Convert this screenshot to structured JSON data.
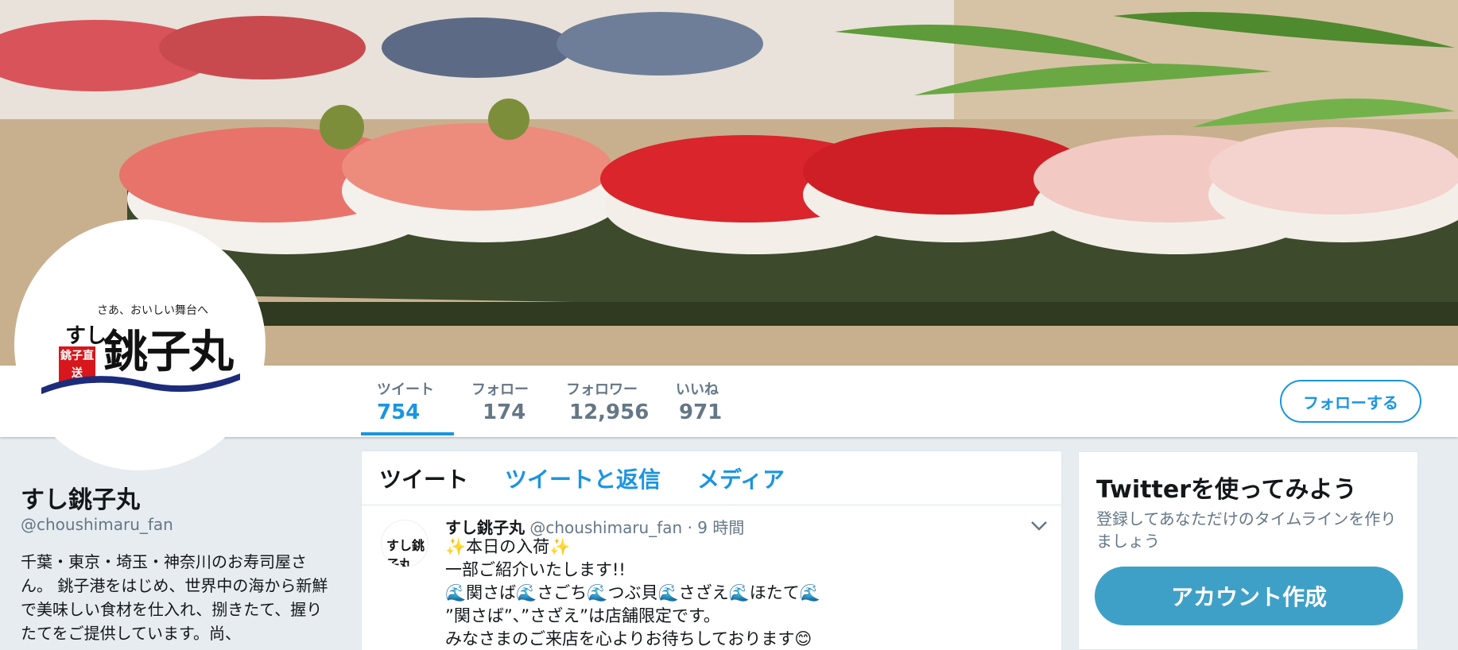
{
  "profile": {
    "avatar_tagline": "さあ、おいしい舞台へ",
    "avatar_prefix": "すし",
    "avatar_brand": "銚子丸",
    "avatar_stamp": "銚子直送",
    "name": "すし銚子丸",
    "handle": "@choushimaru_fan",
    "bio": "千葉・東京・埼玉・神奈川のお寿司屋さん。 銚子港をはじめ、世界中の海から新鮮で美味しい食材を仕入れ、捌きたて、握りたてをご提供しています。尚、"
  },
  "stats": [
    {
      "label": "ツイート",
      "value": "754"
    },
    {
      "label": "フォロー",
      "value": "174"
    },
    {
      "label": "フォロワー",
      "value": "12,956"
    },
    {
      "label": "いいね",
      "value": "971"
    }
  ],
  "follow_button": "フォローする",
  "tabs": [
    "ツイート",
    "ツイートと返信",
    "メディア"
  ],
  "tweet": {
    "avatar_label": "すし銚子丸",
    "name": "すし銚子丸",
    "handle": "@choushimaru_fan",
    "separator": "·",
    "time": "9 時間",
    "caret_icon": "chevron-down-icon",
    "lines": [
      "✨本日の入荷✨",
      "一部ご紹介いたします!!",
      "🌊関さば🌊さごち🌊つぶ貝🌊さざえ🌊ほたて🌊",
      "”関さば”、”さざえ”は店舗限定です。",
      "みなさまのご来店を心よりお待ちしております😊"
    ]
  },
  "signup": {
    "title": "Twitterを使ってみよう",
    "description": "登録してあなただけのタイムラインを作りましょう",
    "button": "アカウント作成"
  },
  "colors": {
    "accent": "#1b95e0",
    "signup_button": "#3fa0c7",
    "muted": "#657786",
    "background": "#e6ecf0"
  }
}
